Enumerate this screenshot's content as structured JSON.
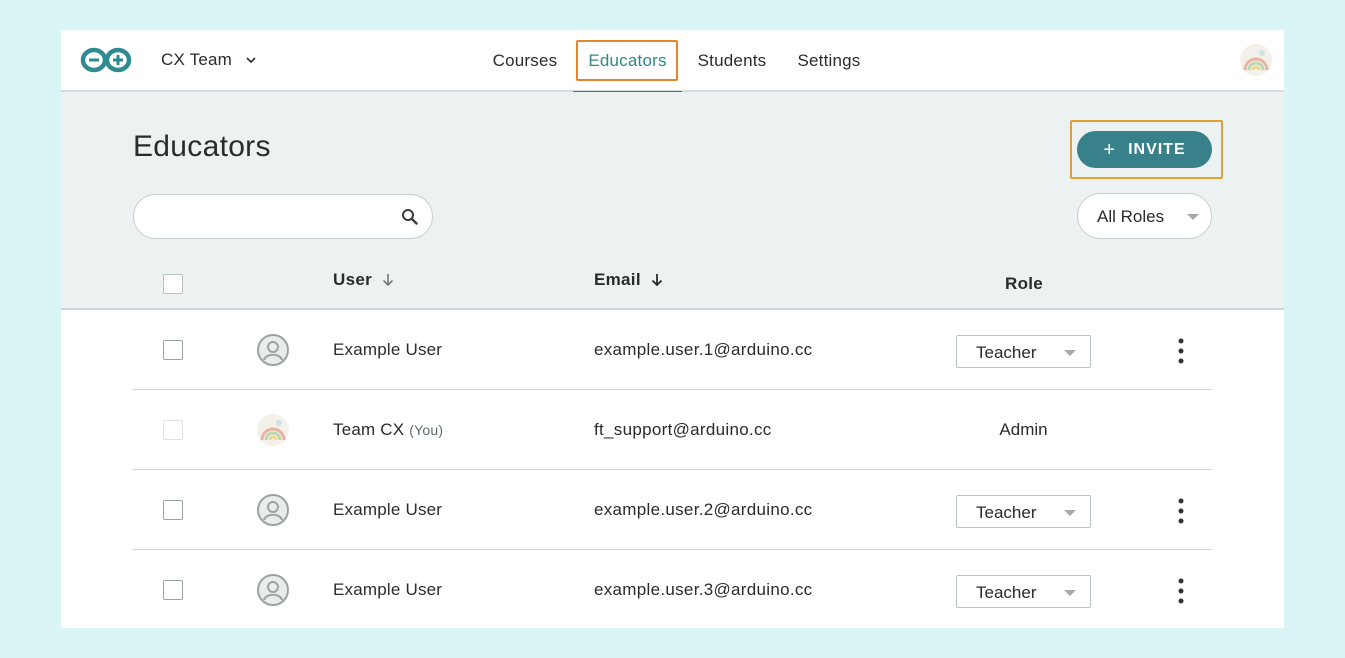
{
  "topbar": {
    "team_name": "CX Team",
    "nav": {
      "courses": "Courses",
      "educators": "Educators",
      "students": "Students",
      "settings": "Settings"
    },
    "active_tab": "Educators"
  },
  "page": {
    "title": "Educators",
    "invite_label": "INVITE",
    "search_placeholder": "",
    "roles_filter": "All Roles"
  },
  "table": {
    "columns": {
      "user": "User",
      "email": "Email",
      "role": "Role"
    },
    "rows": [
      {
        "name": "Example User",
        "you": "",
        "email": "example.user.1@arduino.cc",
        "role": "Teacher",
        "editable": true
      },
      {
        "name": "Team CX",
        "you": "(You)",
        "email": "ft_support@arduino.cc",
        "role": "Admin",
        "editable": false
      },
      {
        "name": "Example User",
        "you": "",
        "email": "example.user.2@arduino.cc",
        "role": "Teacher",
        "editable": true
      },
      {
        "name": "Example User",
        "you": "",
        "email": "example.user.3@arduino.cc",
        "role": "Teacher",
        "editable": true
      }
    ]
  },
  "colors": {
    "accent": "#2f7f80",
    "invite_button": "#38808a",
    "highlight_nav": "#e2852d",
    "highlight_invite": "#e2a02d",
    "page_background": "#daf5f5",
    "header_background": "#ecf1f1"
  },
  "icons": {
    "logo": "arduino-infinity-logo",
    "team_dropdown": "chevron-down-icon",
    "search": "search-icon",
    "sort": "arrow-down-icon",
    "user_placeholder": "user-circle-icon",
    "more": "kebab-menu-icon"
  }
}
